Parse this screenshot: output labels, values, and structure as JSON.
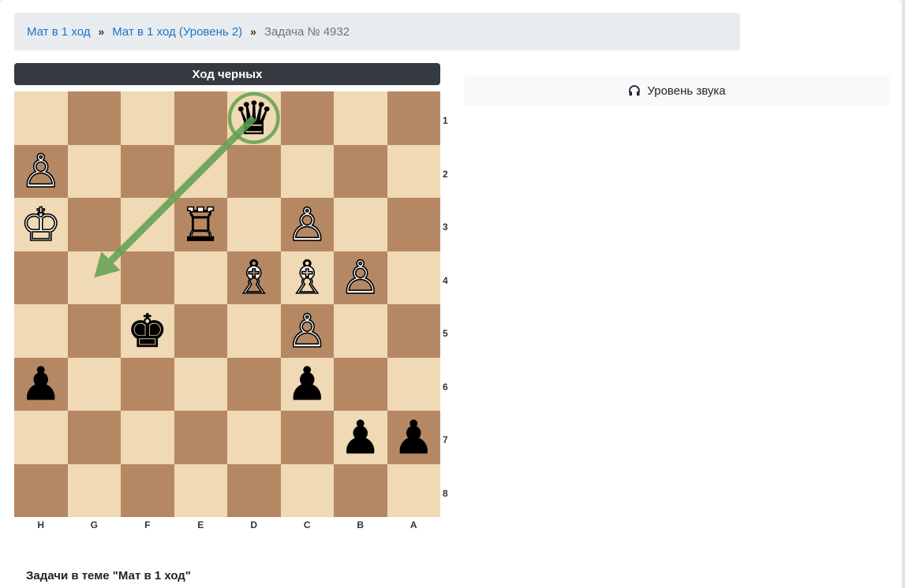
{
  "breadcrumb": {
    "items": [
      "Мат в 1 ход",
      "Мат в 1 ход (Уровень 2)"
    ],
    "separator": "»",
    "current": "Задача № 4932"
  },
  "turn_label": "Ход черных",
  "sound_button": {
    "label": "Уровень звука",
    "icon": "headphones-icon"
  },
  "board": {
    "files": [
      "H",
      "G",
      "F",
      "E",
      "D",
      "C",
      "B",
      "A"
    ],
    "ranks": [
      "1",
      "2",
      "3",
      "4",
      "5",
      "6",
      "7",
      "8"
    ],
    "light_color": "#f0d9b5",
    "dark_color": "#b58863",
    "arrow_color": "#5fa04e",
    "pieces": [
      {
        "square": "d1",
        "type": "queen",
        "color": "black"
      },
      {
        "square": "h2",
        "type": "pawn",
        "color": "white"
      },
      {
        "square": "h3",
        "type": "king",
        "color": "white"
      },
      {
        "square": "e3",
        "type": "rook",
        "color": "white"
      },
      {
        "square": "c3",
        "type": "pawn",
        "color": "white"
      },
      {
        "square": "d4",
        "type": "bishop",
        "color": "white"
      },
      {
        "square": "c4",
        "type": "bishop",
        "color": "white"
      },
      {
        "square": "b4",
        "type": "pawn",
        "color": "white"
      },
      {
        "square": "f5",
        "type": "king",
        "color": "black"
      },
      {
        "square": "c5",
        "type": "pawn",
        "color": "white"
      },
      {
        "square": "h6",
        "type": "pawn",
        "color": "black"
      },
      {
        "square": "c6",
        "type": "pawn",
        "color": "black"
      },
      {
        "square": "b7",
        "type": "pawn",
        "color": "black"
      },
      {
        "square": "a7",
        "type": "pawn",
        "color": "black"
      }
    ],
    "highlight_square": "d1",
    "arrow": {
      "from": "d1",
      "to": "g4"
    }
  },
  "section_title": "Задачи в теме \"Мат в 1 ход\""
}
